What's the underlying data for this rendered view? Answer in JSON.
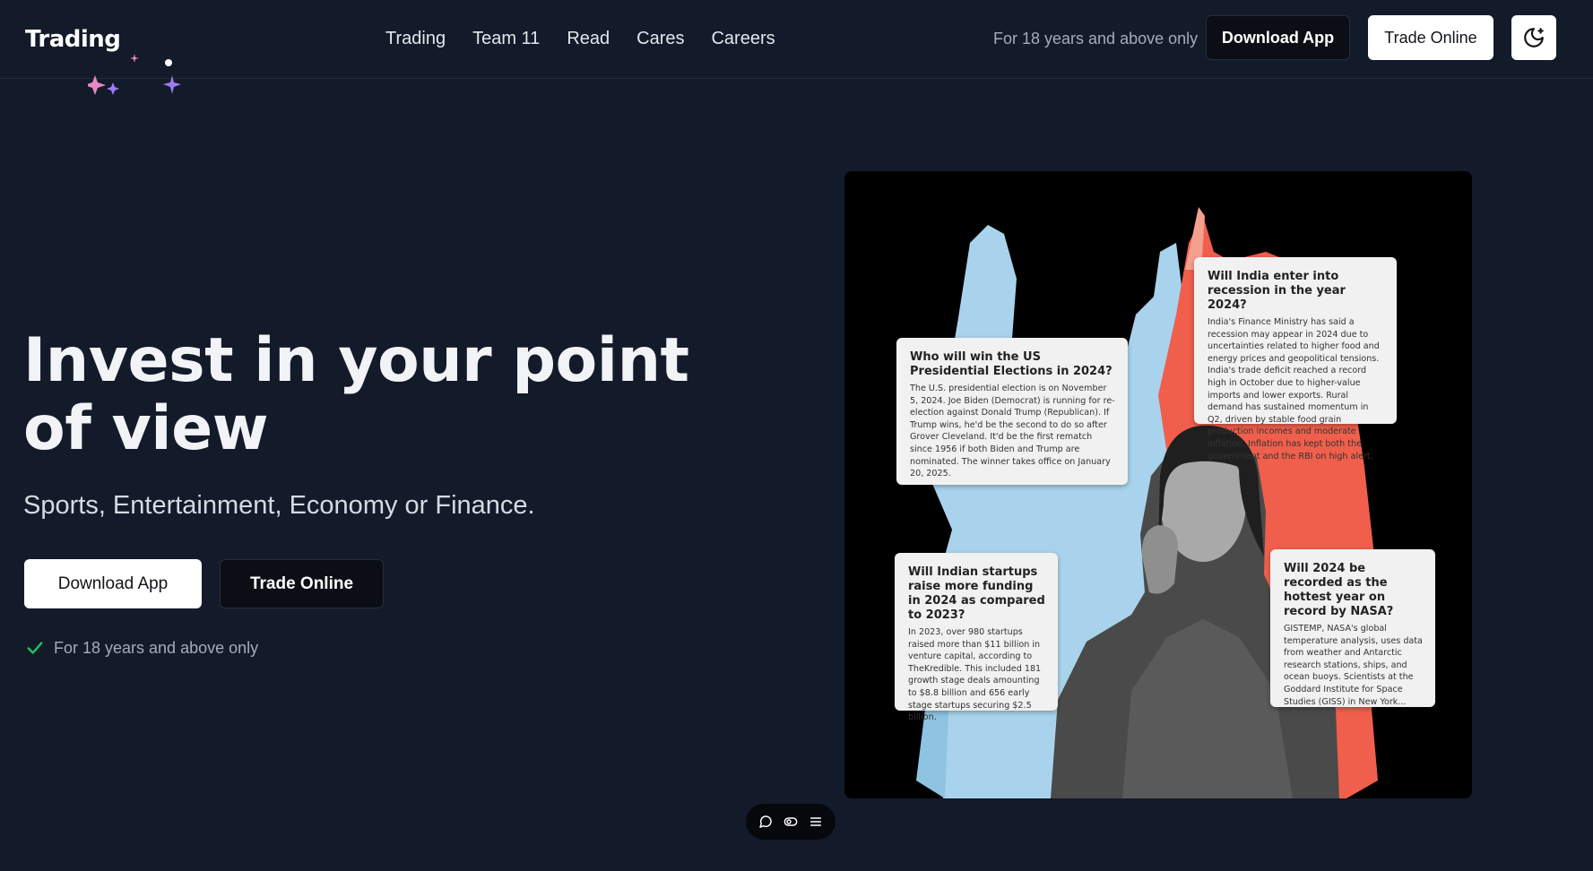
{
  "brand": {
    "logo_text": "Trading"
  },
  "nav": {
    "items": [
      {
        "label": "Trading"
      },
      {
        "label": "Team 11"
      },
      {
        "label": "Read"
      },
      {
        "label": "Cares"
      },
      {
        "label": "Careers"
      }
    ]
  },
  "header": {
    "age_note": "For 18 years and above only",
    "download_label": "Download App",
    "trade_label": "Trade Online",
    "theme_icon": "moon-star-icon"
  },
  "hero": {
    "title": "Invest in your point of view",
    "subtitle": "Sports, Entertainment, Economy or Finance.",
    "download_label": "Download App",
    "trade_label": "Trade Online",
    "age_note": "For 18 years and above only",
    "check_color": "#22c55e"
  },
  "cards": [
    {
      "title": "Who will win the US Presidential Elections in 2024?",
      "body": "The U.S. presidential election is on November 5, 2024. Joe Biden (Democrat) is running for re-election against Donald Trump (Republican). If Trump wins, he'd be the second to do so after Grover Cleveland. It'd be the first rematch since 1956 if both Biden and Trump are nominated. The winner takes office on January 20, 2025."
    },
    {
      "title": "Will India enter into recession in the year 2024?",
      "body": "India's Finance Ministry has said a recession may appear in 2024 due to uncertainties related to higher food and energy prices and geopolitical tensions. India's trade deficit reached a record high in October due to higher-value imports and lower exports. Rural demand has sustained momentum in Q2, driven by stable food grain production incomes and moderate inflation. Inflation has kept both the government and the RBI on high alert."
    },
    {
      "title": "Will Indian startups raise more funding in 2024 as compared to 2023?",
      "body": "In 2023, over 980 startups raised more than $11 billion in venture capital, according to TheKredible. This included 181 growth stage deals amounting to $8.8 billion and 656 early stage startups securing $2.5 billion."
    },
    {
      "title": "Will 2024 be recorded as the hottest year on record by NASA?",
      "body": "GISTEMP, NASA's global temperature analysis, uses data from weather and Antarctic research stations, ships, and ocean buoys. Scientists at the Goddard Institute for Space Studies (GISS) in New York..."
    }
  ],
  "toolbar": {
    "icons": [
      "chat-bubble-icon",
      "toggle-icon",
      "menu-icon"
    ]
  },
  "colors": {
    "background": "#131a2a",
    "splash_blue": "#a9d3ec",
    "splash_red": "#f05f4c"
  }
}
